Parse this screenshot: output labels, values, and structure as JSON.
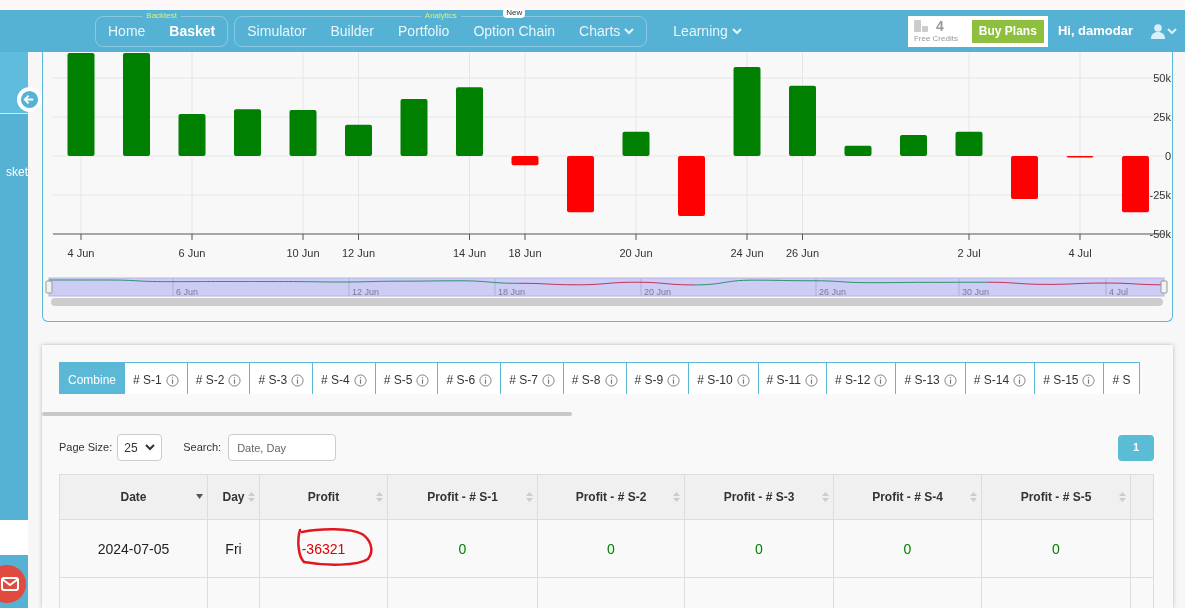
{
  "nav": {
    "groups": [
      {
        "label": "Backtest",
        "items": [
          {
            "label": "Home",
            "selected": false,
            "dropdown": false
          },
          {
            "label": "Basket",
            "selected": true,
            "dropdown": false
          }
        ]
      },
      {
        "label": "Analytics",
        "items": [
          {
            "label": "Simulator",
            "selected": false,
            "dropdown": false
          },
          {
            "label": "Builder",
            "selected": false,
            "dropdown": false
          },
          {
            "label": "Portfolio",
            "selected": false,
            "dropdown": false
          },
          {
            "label": "Option Chain",
            "selected": false,
            "dropdown": false,
            "badge": "New"
          },
          {
            "label": "Charts",
            "selected": false,
            "dropdown": true
          }
        ]
      }
    ],
    "extra": [
      {
        "label": "Learning",
        "selected": false,
        "dropdown": true
      }
    ]
  },
  "credits": {
    "count": "4",
    "label": "Free Credits",
    "button": "Buy Plans"
  },
  "user": {
    "greeting": "Hi, damodar"
  },
  "sidebar": {
    "item": "sket"
  },
  "chart_data": {
    "type": "bar",
    "categories": [
      "4 Jun",
      null,
      "6 Jun",
      null,
      "10 Jun",
      "12 Jun",
      null,
      "14 Jun",
      "18 Jun",
      null,
      "20 Jun",
      null,
      "24 Jun",
      "26 Jun",
      null,
      null,
      "2 Jul",
      null,
      "4 Jul",
      null
    ],
    "grid": true,
    "series": [
      {
        "color": "#008000",
        "values": [
          66000,
          66000,
          27000,
          30000,
          29500,
          20000,
          36500,
          44000,
          null,
          null,
          15500,
          null,
          57000,
          45000,
          6500,
          13500,
          15500,
          null,
          null,
          null
        ]
      },
      {
        "color": "#ff0000",
        "values": [
          null,
          null,
          null,
          null,
          null,
          null,
          null,
          null,
          -6000,
          -36000,
          null,
          -38500,
          null,
          null,
          null,
          null,
          null,
          -27500,
          -600,
          -36000
        ]
      }
    ],
    "ylim": [
      -50000,
      66667
    ],
    "yticks": [
      {
        "value": 50000,
        "label": "50k"
      },
      {
        "value": 25000,
        "label": "25k"
      },
      {
        "value": 0,
        "label": "0"
      },
      {
        "value": -25000,
        "label": "-25k"
      },
      {
        "value": -50000,
        "label": "-50k"
      }
    ]
  },
  "navigator": {
    "labels": [
      "6 Jun",
      "12 Jun",
      "18 Jun",
      "20 Jun",
      "26 Jun",
      "30 Jun",
      "4 Jul"
    ]
  },
  "tabs": [
    {
      "label": "Combine",
      "selected": true,
      "info": false
    },
    {
      "label": "# S-1",
      "selected": false,
      "info": true
    },
    {
      "label": "# S-2",
      "selected": false,
      "info": true
    },
    {
      "label": "# S-3",
      "selected": false,
      "info": true
    },
    {
      "label": "# S-4",
      "selected": false,
      "info": true
    },
    {
      "label": "# S-5",
      "selected": false,
      "info": true
    },
    {
      "label": "# S-6",
      "selected": false,
      "info": true
    },
    {
      "label": "# S-7",
      "selected": false,
      "info": true
    },
    {
      "label": "# S-8",
      "selected": false,
      "info": true
    },
    {
      "label": "# S-9",
      "selected": false,
      "info": true
    },
    {
      "label": "# S-10",
      "selected": false,
      "info": true
    },
    {
      "label": "# S-11",
      "selected": false,
      "info": true
    },
    {
      "label": "# S-12",
      "selected": false,
      "info": true
    },
    {
      "label": "# S-13",
      "selected": false,
      "info": true
    },
    {
      "label": "# S-14",
      "selected": false,
      "info": true
    },
    {
      "label": "# S-15",
      "selected": false,
      "info": true
    },
    {
      "label": "# S",
      "selected": false,
      "info": false
    }
  ],
  "controls": {
    "page_size_label": "Page Size:",
    "page_size": "25",
    "search_label": "Search:",
    "search_placeholder": "Date, Day"
  },
  "pagination": [
    {
      "label": "1",
      "selected": true
    }
  ],
  "table": {
    "columns": [
      {
        "label": "Date",
        "sorted": true
      },
      {
        "label": "Day",
        "sorted": false
      },
      {
        "label": "Profit",
        "sorted": false
      },
      {
        "label": "Profit - # S-1",
        "sorted": false
      },
      {
        "label": "Profit - # S-2",
        "sorted": false
      },
      {
        "label": "Profit - # S-3",
        "sorted": false
      },
      {
        "label": "Profit - # S-4",
        "sorted": false
      },
      {
        "label": "Profit - # S-5",
        "sorted": false
      }
    ],
    "rows": [
      {
        "cells": [
          {
            "text": "2024-07-05",
            "color": "#222222",
            "circled": false
          },
          {
            "text": "Fri",
            "color": "#222222",
            "circled": false
          },
          {
            "text": "-36321",
            "color": "#e00000",
            "circled": true
          },
          {
            "text": "0",
            "color": "#008000",
            "circled": false
          },
          {
            "text": "0",
            "color": "#008000",
            "circled": false
          },
          {
            "text": "0",
            "color": "#008000",
            "circled": false
          },
          {
            "text": "0",
            "color": "#008000",
            "circled": false
          },
          {
            "text": "0",
            "color": "#008000",
            "circled": false
          }
        ]
      }
    ]
  }
}
